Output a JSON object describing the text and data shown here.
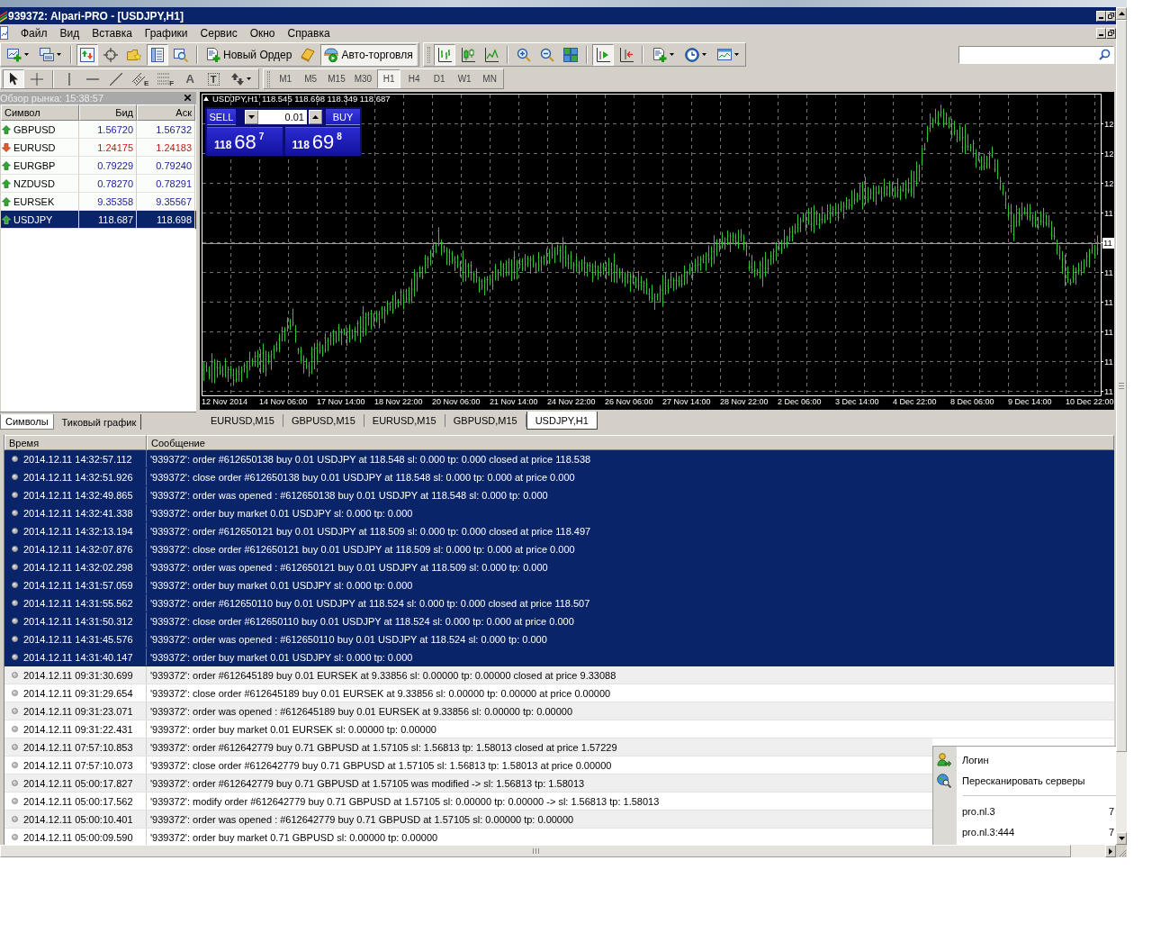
{
  "window": {
    "title": "939372: Alpari-PRO - [USDJPY,H1]"
  },
  "menu": [
    {
      "label": "Файл"
    },
    {
      "label": "Вид"
    },
    {
      "label": "Вставка"
    },
    {
      "label": "Графики"
    },
    {
      "label": "Сервис"
    },
    {
      "label": "Окно"
    },
    {
      "label": "Справка"
    }
  ],
  "main_toolbar_row": {
    "toolbars": [
      {
        "groups": [
          {
            "items": [
              {
                "kind": "new-chart",
                "on": false
              },
              {
                "kind": "profiles",
                "on": false
              }
            ]
          },
          {
            "items": [
              {
                "kind": "market-watch",
                "on": true
              },
              {
                "kind": "data-window",
                "on": false
              },
              {
                "kind": "navigator",
                "on": false
              },
              {
                "kind": "terminal",
                "on": true
              },
              {
                "kind": "tester",
                "on": false
              }
            ]
          },
          {
            "items": [
              {
                "kind": "new-order",
                "label": "Новый Ордер",
                "on": false
              },
              {
                "kind": "editor",
                "on": false
              },
              {
                "kind": "auto-trading",
                "label": "Авто-торговля",
                "on": true
              }
            ]
          }
        ]
      },
      {
        "groups": [
          {
            "items": [
              {
                "kind": "bar-chart",
                "on": true
              },
              {
                "kind": "candles",
                "on": false
              },
              {
                "kind": "line",
                "on": false
              }
            ]
          },
          {
            "items": [
              {
                "kind": "zoom-in",
                "on": false
              },
              {
                "kind": "zoom-out",
                "on": false
              },
              {
                "kind": "tile",
                "on": false
              }
            ]
          },
          {
            "items": [
              {
                "kind": "auto-scroll",
                "on": true
              },
              {
                "kind": "chart-shift",
                "on": false
              }
            ]
          },
          {
            "items": [
              {
                "kind": "indicators",
                "on": false
              },
              {
                "kind": "periods",
                "on": false
              },
              {
                "kind": "templates",
                "on": false
              }
            ]
          }
        ]
      }
    ]
  },
  "second_toolbar_row": {
    "toolbars": [
      {
        "groups": [
          {
            "items": [
              {
                "kind": "cursor",
                "on": true
              },
              {
                "kind": "crosshair",
                "on": false
              }
            ]
          },
          {
            "items": [
              {
                "kind": "vertical-line",
                "on": false
              },
              {
                "kind": "horizontal-line",
                "on": false
              },
              {
                "kind": "trendline",
                "on": false
              },
              {
                "kind": "channel",
                "glyph": "E",
                "on": false
              },
              {
                "kind": "fibo",
                "glyph": "F",
                "on": false
              },
              {
                "kind": "text",
                "glyph": "A",
                "on": false
              },
              {
                "kind": "label",
                "glyph": "T",
                "on": false
              },
              {
                "kind": "arrows",
                "on": false
              }
            ]
          }
        ]
      },
      {
        "groups": [
          {
            "items": [
              {
                "kind": "period",
                "label": "M1",
                "selected": false
              },
              {
                "kind": "period",
                "label": "M5",
                "selected": false
              },
              {
                "kind": "period",
                "label": "M15",
                "selected": false
              },
              {
                "kind": "period",
                "label": "M30",
                "selected": false
              },
              {
                "kind": "period",
                "label": "H1",
                "selected": true
              },
              {
                "kind": "period",
                "label": "H4",
                "selected": false
              },
              {
                "kind": "period",
                "label": "D1",
                "selected": false
              },
              {
                "kind": "period",
                "label": "W1",
                "selected": false
              },
              {
                "kind": "period",
                "label": "MN",
                "selected": false
              }
            ]
          }
        ]
      }
    ]
  },
  "market_watch": {
    "title": "Обзор рынка: 15:38:57",
    "columns": [
      "Символ",
      "Бид",
      "Аск"
    ],
    "rows": [
      {
        "symbol": "GBPUSD",
        "bid": "1.56720",
        "ask": "1.56732",
        "rising": true,
        "selected": false
      },
      {
        "symbol": "EURUSD",
        "bid": "1.24175",
        "ask": "1.24183",
        "rising": false,
        "selected": false
      },
      {
        "symbol": "EURGBP",
        "bid": "0.79229",
        "ask": "0.79240",
        "rising": true,
        "selected": false
      },
      {
        "symbol": "NZDUSD",
        "bid": "0.78270",
        "ask": "0.78291",
        "rising": true,
        "selected": false
      },
      {
        "symbol": "EURSEK",
        "bid": "9.35358",
        "ask": "9.35567",
        "rising": true,
        "selected": false
      },
      {
        "symbol": "USDJPY",
        "bid": "118.687",
        "ask": "118.698",
        "rising": true,
        "selected": true
      }
    ],
    "tabs": [
      {
        "label": "Символы",
        "selected": true
      },
      {
        "label": "Тиковый график",
        "selected": false
      }
    ]
  },
  "chart": {
    "symbol": "USDJPY,H1",
    "ohlc": "118.545 118.698 118.349 118.687",
    "trade_panel": {
      "sell": "SELL",
      "buy": "BUY",
      "volume": "0.01",
      "sell_price": {
        "figure": "118",
        "pips": "68",
        "point": "7"
      },
      "buy_price": {
        "figure": "118",
        "pips": "69",
        "point": "8"
      }
    },
    "price_labels": [
      "12",
      "12",
      "12",
      "11",
      "11",
      "11",
      "11",
      "11",
      "11"
    ],
    "current_price_label": "11",
    "time_labels": [
      "12 Nov 2014",
      "14 Nov 06:00",
      "17 Nov 14:00",
      "18 Nov 22:00",
      "20 Nov 06:00",
      "21 Nov 14:00",
      "24 Nov 22:00",
      "26 Nov 06:00",
      "27 Nov 14:00",
      "28 Nov 22:00",
      "2 Dec 06:00",
      "3 Dec 14:00",
      "4 Dec 22:00",
      "8 Dec 06:00",
      "9 Dec 14:00",
      "10 Dec 22:00"
    ]
  },
  "chart_tabs": [
    {
      "label": "EURUSD,M15",
      "selected": false
    },
    {
      "label": "GBPUSD,M15",
      "selected": false
    },
    {
      "label": "EURUSD,M15",
      "selected": false
    },
    {
      "label": "GBPUSD,M15",
      "selected": false
    },
    {
      "label": "USDJPY,H1",
      "selected": true
    }
  ],
  "terminal_log": {
    "columns": [
      "Время",
      "Сообщение"
    ],
    "rows": [
      {
        "time": "2014.12.11 14:32:57.112",
        "message": "'939372': order #612650138 buy 0.01 USDJPY at 118.548 sl: 0.000 tp: 0.000 closed at price 118.538",
        "selected": true
      },
      {
        "time": "2014.12.11 14:32:51.926",
        "message": "'939372': close order #612650138 buy 0.01 USDJPY at 118.548 sl: 0.000 tp: 0.000 at price 0.000",
        "selected": true
      },
      {
        "time": "2014.12.11 14:32:49.865",
        "message": "'939372': order was opened : #612650138 buy 0.01 USDJPY at 118.548 sl: 0.000 tp: 0.000",
        "selected": true
      },
      {
        "time": "2014.12.11 14:32:41.338",
        "message": "'939372': order buy market 0.01 USDJPY sl: 0.000 tp: 0.000",
        "selected": true
      },
      {
        "time": "2014.12.11 14:32:13.194",
        "message": "'939372': order #612650121 buy 0.01 USDJPY at 118.509 sl: 0.000 tp: 0.000 closed at price 118.497",
        "selected": true
      },
      {
        "time": "2014.12.11 14:32:07.876",
        "message": "'939372': close order #612650121 buy 0.01 USDJPY at 118.509 sl: 0.000 tp: 0.000 at price 0.000",
        "selected": true
      },
      {
        "time": "2014.12.11 14:32:02.298",
        "message": "'939372': order was opened : #612650121 buy 0.01 USDJPY at 118.509 sl: 0.000 tp: 0.000",
        "selected": true
      },
      {
        "time": "2014.12.11 14:31:57.059",
        "message": "'939372': order buy market 0.01 USDJPY sl: 0.000 tp: 0.000",
        "selected": true
      },
      {
        "time": "2014.12.11 14:31:55.562",
        "message": "'939372': order #612650110 buy 0.01 USDJPY at 118.524 sl: 0.000 tp: 0.000 closed at price 118.507",
        "selected": true
      },
      {
        "time": "2014.12.11 14:31:50.312",
        "message": "'939372': close order #612650110 buy 0.01 USDJPY at 118.524 sl: 0.000 tp: 0.000 at price 0.000",
        "selected": true
      },
      {
        "time": "2014.12.11 14:31:45.576",
        "message": "'939372': order was opened : #612650110 buy 0.01 USDJPY at 118.524 sl: 0.000 tp: 0.000",
        "selected": true
      },
      {
        "time": "2014.12.11 14:31:40.147",
        "message": "'939372': order buy market 0.01 USDJPY sl: 0.000 tp: 0.000",
        "selected": true
      },
      {
        "time": "2014.12.11 09:31:30.699",
        "message": "'939372': order #612645189 buy 0.01 EURSEK at 9.33856 sl: 0.00000 tp: 0.00000 closed at price 9.33088",
        "selected": false
      },
      {
        "time": "2014.12.11 09:31:29.654",
        "message": "'939372': close order #612645189 buy 0.01 EURSEK at 9.33856 sl: 0.00000 tp: 0.00000 at price 0.00000",
        "selected": false
      },
      {
        "time": "2014.12.11 09:31:23.071",
        "message": "'939372': order was opened : #612645189 buy 0.01 EURSEK at 9.33856 sl: 0.00000 tp: 0.00000",
        "selected": false
      },
      {
        "time": "2014.12.11 09:31:22.431",
        "message": "'939372': order buy market 0.01 EURSEK sl: 0.00000 tp: 0.00000",
        "selected": false
      },
      {
        "time": "2014.12.11 07:57:10.853",
        "message": "'939372': order #612642779 buy 0.71 GBPUSD at 1.57105 sl: 1.56813 tp: 1.58013 closed at price 1.57229",
        "selected": false
      },
      {
        "time": "2014.12.11 07:57:10.073",
        "message": "'939372': close order #612642779 buy 0.71 GBPUSD at 1.57105 sl: 1.56813 tp: 1.58013 at price 0.00000",
        "selected": false
      },
      {
        "time": "2014.12.11 05:00:17.827",
        "message": "'939372': order #612642779 buy 0.71 GBPUSD at 1.57105 was modified -> sl: 1.56813 tp: 1.58013",
        "selected": false
      },
      {
        "time": "2014.12.11 05:00:17.562",
        "message": "'939372': modify order #612642779 buy 0.71 GBPUSD at 1.57105 sl: 0.00000 tp: 0.00000 -> sl: 1.56813 tp: 1.58013",
        "selected": false
      },
      {
        "time": "2014.12.11 05:00:10.401",
        "message": "'939372': order was opened : #612642779 buy 0.71 GBPUSD at 1.57105 sl: 0.00000 tp: 0.00000",
        "selected": false
      },
      {
        "time": "2014.12.11 05:00:09.590",
        "message": "'939372': order buy market 0.71 GBPUSD sl: 0.00000 tp: 0.00000",
        "selected": false
      }
    ]
  },
  "context_menu": {
    "items": [
      {
        "kind": "login",
        "label": "Логин"
      },
      {
        "kind": "rescan",
        "label": "Пересканировать серверы"
      },
      {
        "kind": "separator"
      },
      {
        "kind": "server",
        "label": "pro.nl.3",
        "column_2": "7"
      },
      {
        "kind": "server",
        "label": "pro.nl.3:444",
        "column_2": "7"
      }
    ]
  }
}
